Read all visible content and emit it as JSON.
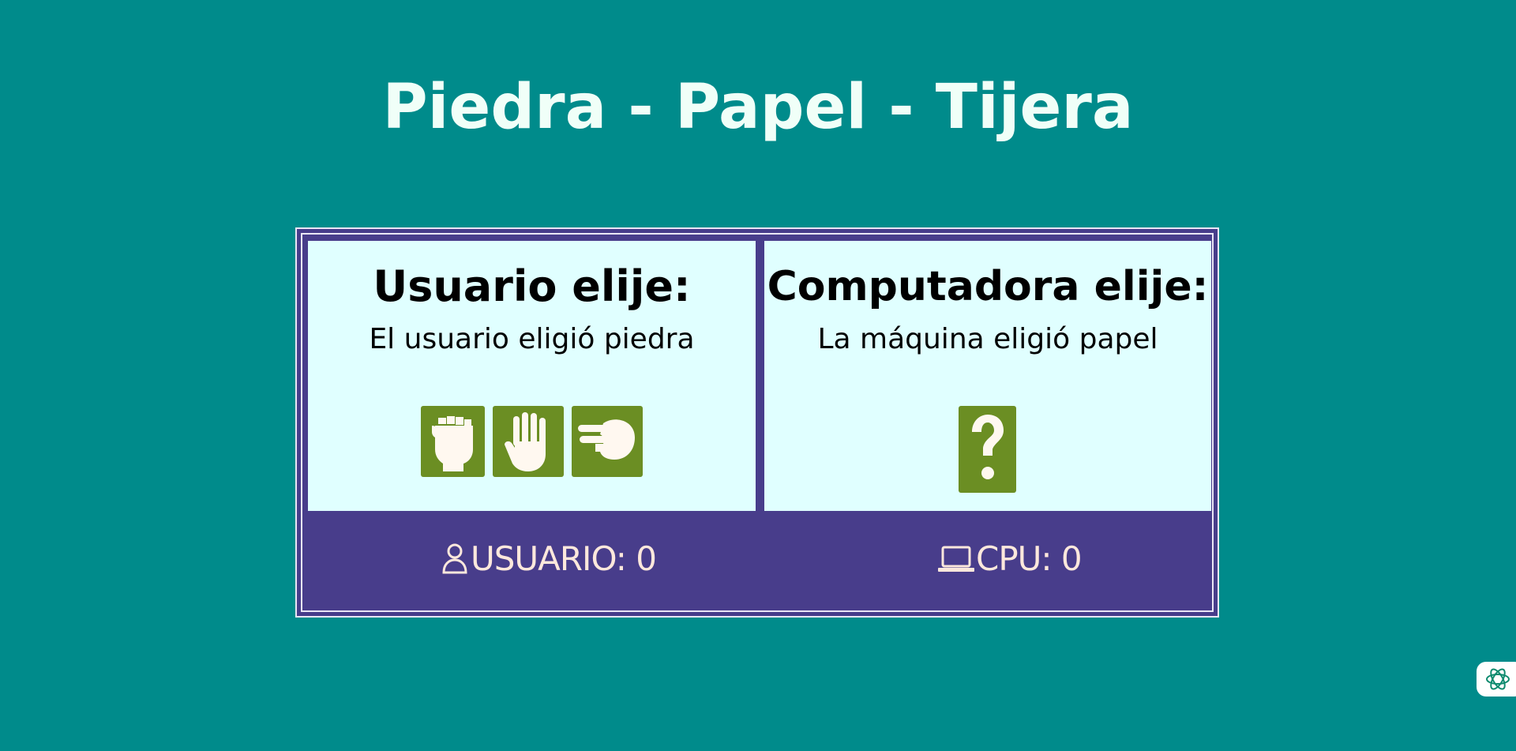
{
  "title": "Piedra - Papel - Tijera",
  "user_panel": {
    "heading": "Usuario elije:",
    "result": "El usuario eligió piedra",
    "choices": [
      {
        "name": "piedra",
        "icon": "fist-icon"
      },
      {
        "name": "papel",
        "icon": "open-hand-icon"
      },
      {
        "name": "tijera",
        "icon": "scissors-hand-icon"
      }
    ]
  },
  "cpu_panel": {
    "heading": "Computadora elije:",
    "result": "La máquina eligió papel",
    "choice_icon": "question-mark-icon"
  },
  "scoreboard": {
    "user_label": "USUARIO: 0",
    "user_icon": "user-icon",
    "cpu_label": "CPU: 0",
    "cpu_icon": "laptop-icon"
  },
  "colors": {
    "background": "#008b8b",
    "panel": "#e0ffff",
    "frame": "#483d8b",
    "button": "#6b8e23",
    "score_text": "#fde8dc"
  }
}
